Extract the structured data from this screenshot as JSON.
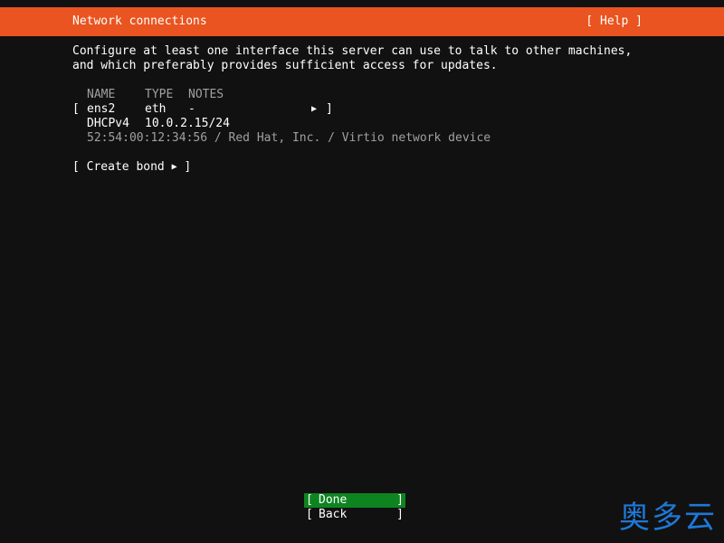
{
  "header": {
    "title": "Network connections",
    "help_label": "[ Help ]"
  },
  "description": {
    "line1": "Configure at least one interface this server can use to talk to other machines,",
    "line2": "and which preferably provides sufficient access for updates."
  },
  "table": {
    "headers": {
      "name": "NAME",
      "type": "TYPE",
      "notes": "NOTES"
    },
    "interfaces": [
      {
        "name": "ens2",
        "type": "eth",
        "notes": "-",
        "arrow": "▶",
        "address_type": "DHCPv4",
        "address": "10.0.2.15/24",
        "hw_info": "52:54:00:12:34:56 / Red Hat, Inc. / Virtio network device"
      }
    ]
  },
  "actions": {
    "create_bond_label": "Create bond",
    "arrow": "▶"
  },
  "buttons": {
    "done_label": "Done",
    "back_label": "Back"
  },
  "watermark": {
    "text": "奥多云"
  },
  "colors": {
    "header_bg": "#e95420",
    "focused_button_bg": "#0e8420",
    "dim_text": "#a0a0a0",
    "background": "#111111"
  }
}
